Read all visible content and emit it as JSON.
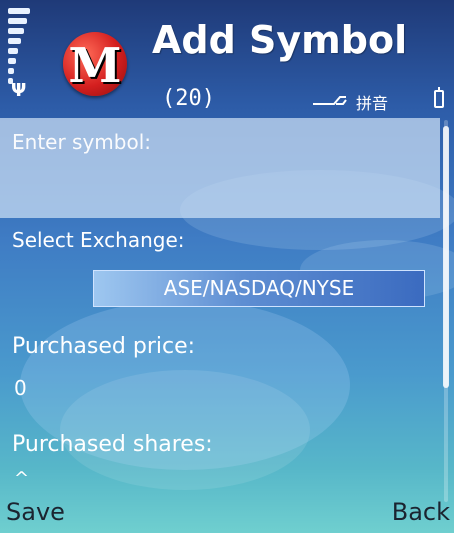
{
  "header": {
    "title": "Add Symbol",
    "count": "(20)",
    "input_mode": "拼音"
  },
  "form": {
    "symbol_label": "Enter symbol:",
    "symbol_value": "",
    "exchange_label": "Select Exchange:",
    "exchange_value": "ASE/NASDAQ/NYSE",
    "price_label": "Purchased price:",
    "price_value": "0",
    "shares_label": "Purchased shares:",
    "shares_value": "^"
  },
  "softkeys": {
    "left": "Save",
    "right": "Back"
  },
  "icons": {
    "signal": "signal-strength-icon",
    "antenna": "antenna-icon",
    "app": "app-logo-m-icon",
    "pen": "pen-input-icon",
    "battery": "battery-icon"
  },
  "colors": {
    "background_top": "#1f3a78",
    "background_bottom": "#6fcfcf",
    "logo_red": "#d41f1f",
    "softkey_text": "#1b2430"
  }
}
